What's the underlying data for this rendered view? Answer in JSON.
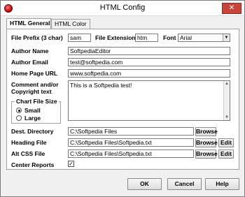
{
  "window": {
    "title": "HTML Config"
  },
  "tabs": [
    {
      "label": "HTML General"
    },
    {
      "label": "HTML Color"
    }
  ],
  "fields": {
    "file_prefix": {
      "label": "File Prefix (3 char)",
      "value": "sam"
    },
    "file_extension": {
      "label": "File Extension",
      "value": "htm"
    },
    "font": {
      "label": "Font",
      "value": "Arial"
    },
    "author_name": {
      "label": "Author Name",
      "value": "SoftpediaEditor"
    },
    "author_email": {
      "label": "Author Email",
      "value": "test@softpedia.com"
    },
    "home_page_url": {
      "label": "Home Page URL",
      "value": "www.softpedia.com"
    },
    "comment": {
      "label_line1": "Comment and/or",
      "label_line2": "Copyright text",
      "value": "This is a Softpedia test!"
    },
    "dest_directory": {
      "label": "Dest. Directory",
      "value": "C:\\Softpedia Files"
    },
    "heading_file": {
      "label": "Heading File",
      "value": "C:\\Softpedia Files\\Softpedia.txt"
    },
    "alt_css_file": {
      "label": "Alt CSS File",
      "value": "C:\\Softpedia Files\\Softpedia.txt"
    },
    "center_reports": {
      "label": "Center Reports",
      "checked": true
    }
  },
  "chart_file_size": {
    "title": "Chart File Size",
    "options": [
      {
        "label": "Small",
        "selected": true
      },
      {
        "label": "Large",
        "selected": false
      }
    ]
  },
  "buttons": {
    "browse": "Browse",
    "edit": "Edit",
    "ok": "OK",
    "cancel": "Cancel",
    "help": "Help"
  }
}
